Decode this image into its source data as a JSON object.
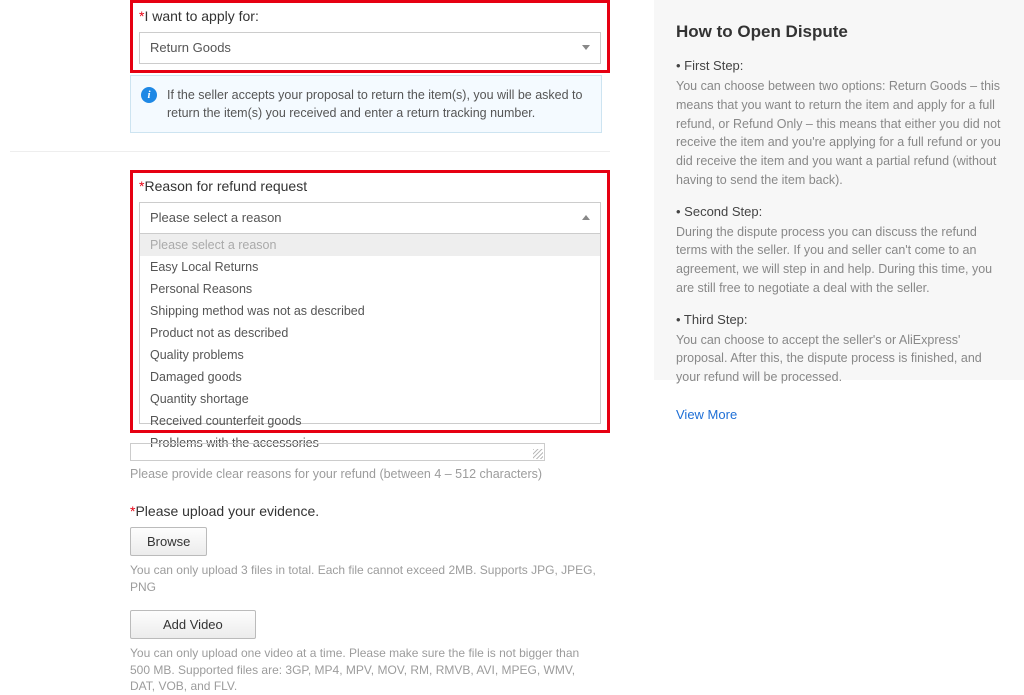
{
  "apply": {
    "label": "I want to apply for:",
    "selected": "Return Goods"
  },
  "infoNotice": "If the seller accepts your proposal to return the item(s), you will be asked to return the item(s) you received and enter a return tracking number.",
  "reason": {
    "label": "Reason for refund request",
    "selected": "Please select a reason",
    "options": [
      "Please select a reason",
      "Easy Local Returns",
      "Personal Reasons",
      "Shipping method was not as described",
      "Product not as described",
      "Quality problems",
      "Damaged goods",
      "Quantity shortage",
      "Received counterfeit goods",
      "Problems with the accessories"
    ]
  },
  "reasonHint": "Please provide clear reasons for your refund (between 4 – 512 characters)",
  "evidence": {
    "label": "Please upload your evidence.",
    "browse": "Browse",
    "browseHint": "You can only upload 3 files in total. Each file cannot exceed 2MB. Supports JPG, JPEG, PNG",
    "addVideo": "Add Video",
    "videoHint": "You can only upload one video at a time. Please make sure the file is not bigger than 500 MB. Supported files are: 3GP, MP4, MPV, MOV, RM, RMVB, AVI, MPEG, WMV, DAT, VOB, and FLV."
  },
  "help": {
    "title": "How to Open Dispute",
    "steps": [
      {
        "title": "• First Step:",
        "body": "You can choose between two options: Return Goods – this means that you want to return the item and apply for a full refund, or Refund Only – this means that either you did not receive the item and you're applying for a full refund or you did receive the item and you want a partial refund (without having to send the item back)."
      },
      {
        "title": "• Second Step:",
        "body": "During the dispute process you can discuss the refund terms with the seller. If you and seller can't come to an agreement, we will step in and help. During this time, you are still free to negotiate a deal with the seller."
      },
      {
        "title": "• Third Step:",
        "body": "You can choose to accept the seller's or AliExpress' proposal. After this, the dispute process is finished, and your refund will be processed."
      }
    ],
    "viewMore": "View More"
  }
}
